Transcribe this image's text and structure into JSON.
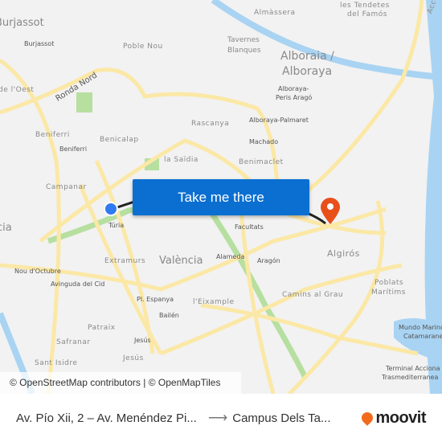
{
  "map": {
    "cta_label": "Take me there",
    "attribution": "© OpenStreetMap contributors | © OpenMapTiles",
    "labels": [
      "Almàssera",
      "les Tendetes",
      "del Famós",
      "Burjassot",
      "Burjassot",
      "Poble Nou",
      "Tavernes",
      "Blanques",
      "Alboraia /",
      "Alboraya",
      "Alboraya-",
      "Peris Aragó",
      "de l'Oest",
      "Ronda Nord",
      "Rascanya",
      "Alboraya-Palmaret",
      "Beniferri",
      "Beniferri",
      "Benicalap",
      "Machado",
      "la Saïdia",
      "Benimaclet",
      "Campanar",
      "Túria",
      "Facultats",
      "Extramurs",
      "València",
      "Alameda",
      "Aragón",
      "Algirós",
      "Nou d'Octubre",
      "Avinguda del Cid",
      "Poblats",
      "Marítims",
      "Camins al Grau",
      "Pl. Espanya",
      "l'Eixample",
      "Bailén",
      "Patraix",
      "Mundo Marino",
      "Catamaranes",
      "Safranar",
      "Jesús",
      "Jesús",
      "Sant Isidre",
      "Terminal Acciona",
      "Trasmediterranea",
      "Acc",
      "cia"
    ],
    "colors": {
      "cta": "#0a6fd1",
      "origin": "#2f7af0",
      "destination": "#e8501a",
      "road": "#fbe8a6",
      "water": "#a9d3f2",
      "park": "#b6dfa0"
    }
  },
  "footer": {
    "origin": "Av. Pío Xii, 2 – Av. Menéndez Pi...",
    "destination": "Campus Dels Ta...",
    "brand": "moovit"
  }
}
